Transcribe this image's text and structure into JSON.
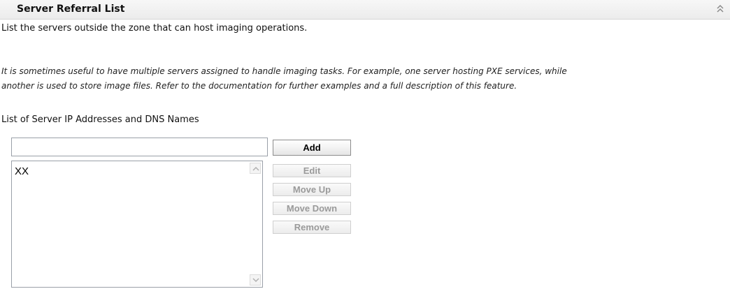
{
  "section": {
    "title": "Server Referral List",
    "collapse_icon": "double-chevron-up-icon"
  },
  "description": "List the servers outside the zone that can host imaging operations.",
  "note": {
    "line1": "It is sometimes useful to have multiple servers assigned to handle imaging tasks. For example, one server hosting PXE services, while",
    "line2": "another is used to store image files. Refer to the documentation for further examples and a full description of this feature."
  },
  "list_label": "List of Server IP Addresses and DNS Names",
  "input": {
    "value": "",
    "placeholder": ""
  },
  "list": {
    "items": [
      "XX"
    ]
  },
  "buttons": {
    "add": "Add",
    "edit": "Edit",
    "move_up": "Move Up",
    "move_down": "Move Down",
    "remove": "Remove"
  }
}
